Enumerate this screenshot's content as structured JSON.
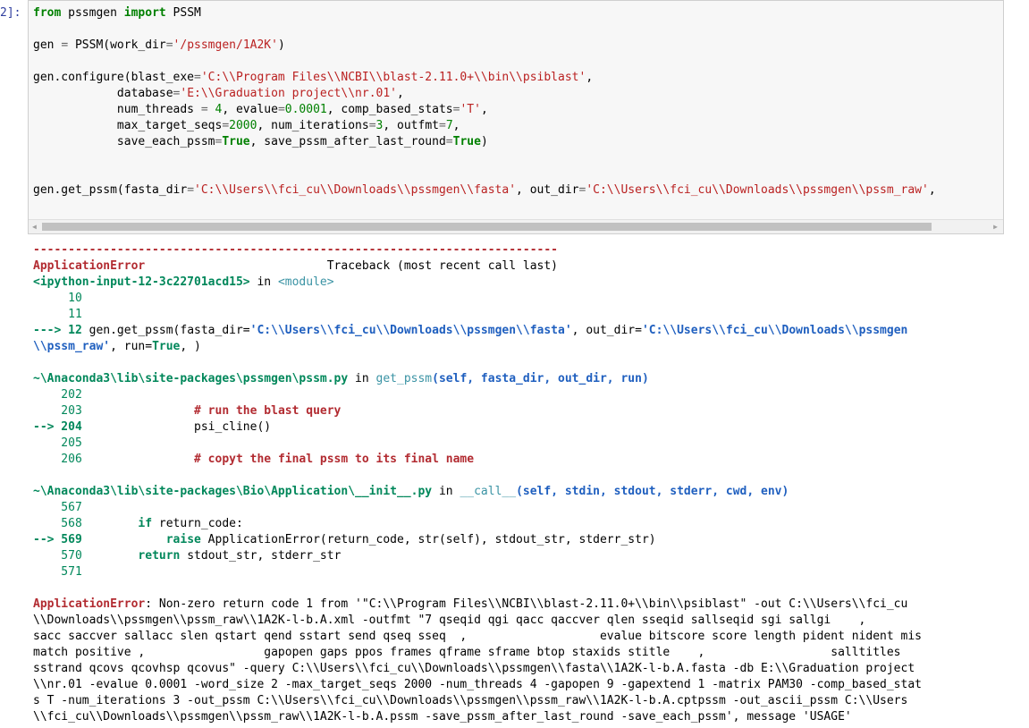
{
  "prompt": "2]:",
  "input_lines": [
    [
      {
        "t": "from",
        "c": "kw"
      },
      {
        "t": " pssmgen ",
        "c": "plain"
      },
      {
        "t": "import",
        "c": "kw"
      },
      {
        "t": " PSSM",
        "c": "plain"
      }
    ],
    [],
    [
      {
        "t": "gen ",
        "c": "plain"
      },
      {
        "t": "=",
        "c": "op"
      },
      {
        "t": " PSSM(work_dir",
        "c": "plain"
      },
      {
        "t": "=",
        "c": "op"
      },
      {
        "t": "'/pssmgen/1A2K'",
        "c": "str"
      },
      {
        "t": ")",
        "c": "plain"
      }
    ],
    [],
    [
      {
        "t": "gen.configure(blast_exe",
        "c": "plain"
      },
      {
        "t": "=",
        "c": "op"
      },
      {
        "t": "'C:\\\\Program Files\\\\NCBI\\\\blast-2.11.0+\\\\bin\\\\psiblast'",
        "c": "str"
      },
      {
        "t": ",",
        "c": "plain"
      }
    ],
    [
      {
        "t": "            database",
        "c": "plain"
      },
      {
        "t": "=",
        "c": "op"
      },
      {
        "t": "'E:\\\\Graduation project\\\\nr.01'",
        "c": "str"
      },
      {
        "t": ",",
        "c": "plain"
      }
    ],
    [
      {
        "t": "            num_threads ",
        "c": "plain"
      },
      {
        "t": "=",
        "c": "op"
      },
      {
        "t": " ",
        "c": "plain"
      },
      {
        "t": "4",
        "c": "num"
      },
      {
        "t": ", evalue",
        "c": "plain"
      },
      {
        "t": "=",
        "c": "op"
      },
      {
        "t": "0.0001",
        "c": "num"
      },
      {
        "t": ", comp_based_stats",
        "c": "plain"
      },
      {
        "t": "=",
        "c": "op"
      },
      {
        "t": "'T'",
        "c": "str"
      },
      {
        "t": ",",
        "c": "plain"
      }
    ],
    [
      {
        "t": "            max_target_seqs",
        "c": "plain"
      },
      {
        "t": "=",
        "c": "op"
      },
      {
        "t": "2000",
        "c": "num"
      },
      {
        "t": ", num_iterations",
        "c": "plain"
      },
      {
        "t": "=",
        "c": "op"
      },
      {
        "t": "3",
        "c": "num"
      },
      {
        "t": ", outfmt",
        "c": "plain"
      },
      {
        "t": "=",
        "c": "op"
      },
      {
        "t": "7",
        "c": "num"
      },
      {
        "t": ",",
        "c": "plain"
      }
    ],
    [
      {
        "t": "            save_each_pssm",
        "c": "plain"
      },
      {
        "t": "=",
        "c": "op"
      },
      {
        "t": "True",
        "c": "kw"
      },
      {
        "t": ", save_pssm_after_last_round",
        "c": "plain"
      },
      {
        "t": "=",
        "c": "op"
      },
      {
        "t": "True",
        "c": "kw"
      },
      {
        "t": ")",
        "c": "plain"
      }
    ],
    [],
    [],
    [
      {
        "t": "gen.get_pssm(fasta_dir",
        "c": "plain"
      },
      {
        "t": "=",
        "c": "op"
      },
      {
        "t": "'C:\\\\Users\\\\fci_cu\\\\Downloads\\\\pssmgen\\\\fasta'",
        "c": "str"
      },
      {
        "t": ", out_dir",
        "c": "plain"
      },
      {
        "t": "=",
        "c": "op"
      },
      {
        "t": "'C:\\\\Users\\\\fci_cu\\\\Downloads\\\\pssmgen\\\\pssm_raw'",
        "c": "str"
      },
      {
        "t": ",",
        "c": "plain"
      }
    ]
  ],
  "output_lines": [
    [
      {
        "t": "---------------------------------------------------------------------------",
        "c": "red"
      }
    ],
    [
      {
        "t": "ApplicationError",
        "c": "red"
      },
      {
        "t": "                          Traceback (most recent call last)",
        "c": "plain"
      }
    ],
    [
      {
        "t": "<ipython-input-12-3c22701acd15>",
        "c": "green-b"
      },
      {
        "t": " in ",
        "c": "plain"
      },
      {
        "t": "<module>",
        "c": "cyan"
      }
    ],
    [
      {
        "t": "     10",
        "c": "ln"
      }
    ],
    [
      {
        "t": "     11",
        "c": "ln"
      }
    ],
    [
      {
        "t": "---> 12",
        "c": "green-b"
      },
      {
        "t": " gen.get_pssm(fasta_dir=",
        "c": "plain"
      },
      {
        "t": "'C:\\\\Users\\\\fci_cu\\\\Downloads\\\\pssmgen\\\\fasta'",
        "c": "blue-b"
      },
      {
        "t": ", out_dir=",
        "c": "plain"
      },
      {
        "t": "'C:\\\\Users\\\\fci_cu\\\\Downloads\\\\pssmgen",
        "c": "blue-b"
      }
    ],
    [
      {
        "t": "\\\\pssm_raw'",
        "c": "blue-b"
      },
      {
        "t": ", run=",
        "c": "plain"
      },
      {
        "t": "True",
        "c": "kwo"
      },
      {
        "t": ", )",
        "c": "plain"
      }
    ],
    [],
    [
      {
        "t": "~\\Anaconda3\\lib\\site-packages\\pssmgen\\pssm.py",
        "c": "green-b"
      },
      {
        "t": " in ",
        "c": "plain"
      },
      {
        "t": "get_pssm",
        "c": "cyan"
      },
      {
        "t": "(self, fasta_dir, out_dir, run)",
        "c": "blue-b"
      }
    ],
    [
      {
        "t": "    202",
        "c": "ln"
      }
    ],
    [
      {
        "t": "    203",
        "c": "ln"
      },
      {
        "t": "                # run the blast query",
        "c": "brown"
      }
    ],
    [
      {
        "t": "--> 204",
        "c": "green-b"
      },
      {
        "t": "                psi_cline()",
        "c": "plain"
      }
    ],
    [
      {
        "t": "    205",
        "c": "ln"
      }
    ],
    [
      {
        "t": "    206",
        "c": "ln"
      },
      {
        "t": "                # copyt the final pssm to its final name",
        "c": "brown"
      }
    ],
    [],
    [
      {
        "t": "~\\Anaconda3\\lib\\site-packages\\Bio\\Application\\__init__.py",
        "c": "green-b"
      },
      {
        "t": " in ",
        "c": "plain"
      },
      {
        "t": "__call__",
        "c": "cyan"
      },
      {
        "t": "(self, stdin, stdout, stderr, cwd, env)",
        "c": "blue-b"
      }
    ],
    [
      {
        "t": "    567",
        "c": "ln"
      }
    ],
    [
      {
        "t": "    568",
        "c": "ln"
      },
      {
        "t": "        ",
        "c": "plain"
      },
      {
        "t": "if",
        "c": "kwo"
      },
      {
        "t": " return_code:",
        "c": "plain"
      }
    ],
    [
      {
        "t": "--> 569",
        "c": "green-b"
      },
      {
        "t": "            ",
        "c": "plain"
      },
      {
        "t": "raise",
        "c": "kwo"
      },
      {
        "t": " ApplicationError(return_code, str(self), stdout_str, stderr_str)",
        "c": "plain"
      }
    ],
    [
      {
        "t": "    570",
        "c": "ln"
      },
      {
        "t": "        ",
        "c": "plain"
      },
      {
        "t": "return",
        "c": "kwo"
      },
      {
        "t": " stdout_str, stderr_str",
        "c": "plain"
      }
    ],
    [
      {
        "t": "    571",
        "c": "ln"
      }
    ],
    [],
    [
      {
        "t": "ApplicationError",
        "c": "red"
      },
      {
        "t": ": Non-zero return code 1 from '\"C:\\\\Program Files\\\\NCBI\\\\blast-2.11.0+\\\\bin\\\\psiblast\" -out C:\\\\Users\\\\fci_cu",
        "c": "plain"
      }
    ],
    [
      {
        "t": "\\\\Downloads\\\\pssmgen\\\\pssm_raw\\\\1A2K-l-b.A.xml -outfmt \"7 qseqid qgi qacc qaccver qlen sseqid sallseqid sgi sallgi    ,",
        "c": "plain"
      }
    ],
    [
      {
        "t": "sacc saccver sallacc slen qstart qend sstart send qseq sseq  ,                   evalue bitscore score length pident nident mis",
        "c": "plain"
      }
    ],
    [
      {
        "t": "match positive ,                 gapopen gaps ppos frames qframe sframe btop staxids stitle    ,                  salltitles",
        "c": "plain"
      }
    ],
    [
      {
        "t": "sstrand qcovs qcovhsp qcovus\" -query C:\\\\Users\\\\fci_cu\\\\Downloads\\\\pssmgen\\\\fasta\\\\1A2K-l-b.A.fasta -db E:\\\\Graduation project",
        "c": "plain"
      }
    ],
    [
      {
        "t": "\\\\nr.01 -evalue 0.0001 -word_size 2 -max_target_seqs 2000 -num_threads 4 -gapopen 9 -gapextend 1 -matrix PAM30 -comp_based_stat",
        "c": "plain"
      }
    ],
    [
      {
        "t": "s T -num_iterations 3 -out_pssm C:\\\\Users\\\\fci_cu\\\\Downloads\\\\pssmgen\\\\pssm_raw\\\\1A2K-l-b.A.cptpssm -out_ascii_pssm C:\\\\Users",
        "c": "plain"
      }
    ],
    [
      {
        "t": "\\\\fci_cu\\\\Downloads\\\\pssmgen\\\\pssm_raw\\\\1A2K-l-b.A.pssm -save_pssm_after_last_round -save_each_pssm', message 'USAGE'",
        "c": "plain"
      }
    ]
  ],
  "scroll_left_glyph": "◀",
  "scroll_right_glyph": "▶"
}
